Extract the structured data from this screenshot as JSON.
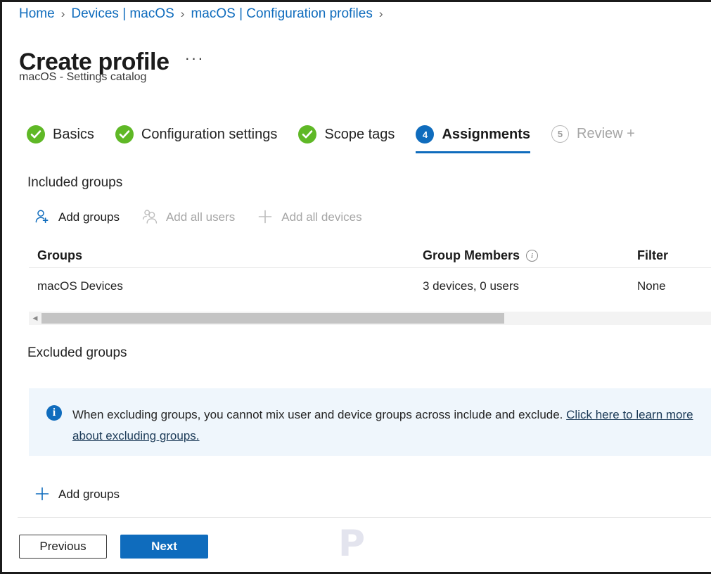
{
  "breadcrumb": {
    "separator": "›",
    "items": [
      {
        "label": "Home"
      },
      {
        "label": "Devices | macOS"
      },
      {
        "label": "macOS | Configuration profiles"
      }
    ]
  },
  "header": {
    "title": "Create profile",
    "more_label": "···",
    "subtitle": "macOS - Settings catalog"
  },
  "wizard": {
    "steps": [
      {
        "number": "1",
        "label": "Basics",
        "state": "done"
      },
      {
        "number": "2",
        "label": "Configuration settings",
        "state": "done"
      },
      {
        "number": "3",
        "label": "Scope tags",
        "state": "done"
      },
      {
        "number": "4",
        "label": "Assignments",
        "state": "current"
      },
      {
        "number": "5",
        "label": "Review + ",
        "state": "pending"
      }
    ]
  },
  "included": {
    "heading": "Included groups",
    "commands": [
      {
        "label": "Add groups",
        "icon": "add-user-icon",
        "enabled": true
      },
      {
        "label": "Add all users",
        "icon": "all-users-icon",
        "enabled": false
      },
      {
        "label": "Add all devices",
        "icon": "plus-icon",
        "enabled": false
      }
    ],
    "table": {
      "columns": {
        "groups": "Groups",
        "members": "Group Members",
        "filter": "Filter"
      },
      "rows": [
        {
          "group": "macOS Devices",
          "members": "3 devices, 0 users",
          "filter": "None"
        }
      ]
    }
  },
  "excluded": {
    "heading": "Excluded groups",
    "banner": {
      "text": "When excluding groups, you cannot mix user and device groups across include and exclude. ",
      "link": "Click here to learn more about excluding groups."
    },
    "add_groups_label": "Add groups"
  },
  "footer": {
    "previous_label": "Previous",
    "next_label": "Next"
  },
  "watermark": {
    "text": "P"
  },
  "colors": {
    "accent": "#0f6cbd",
    "link": "#0f6cbd",
    "success": "#5fb826",
    "banner_bg": "#eff6fc",
    "disabled_text": "#a6a6a6"
  }
}
